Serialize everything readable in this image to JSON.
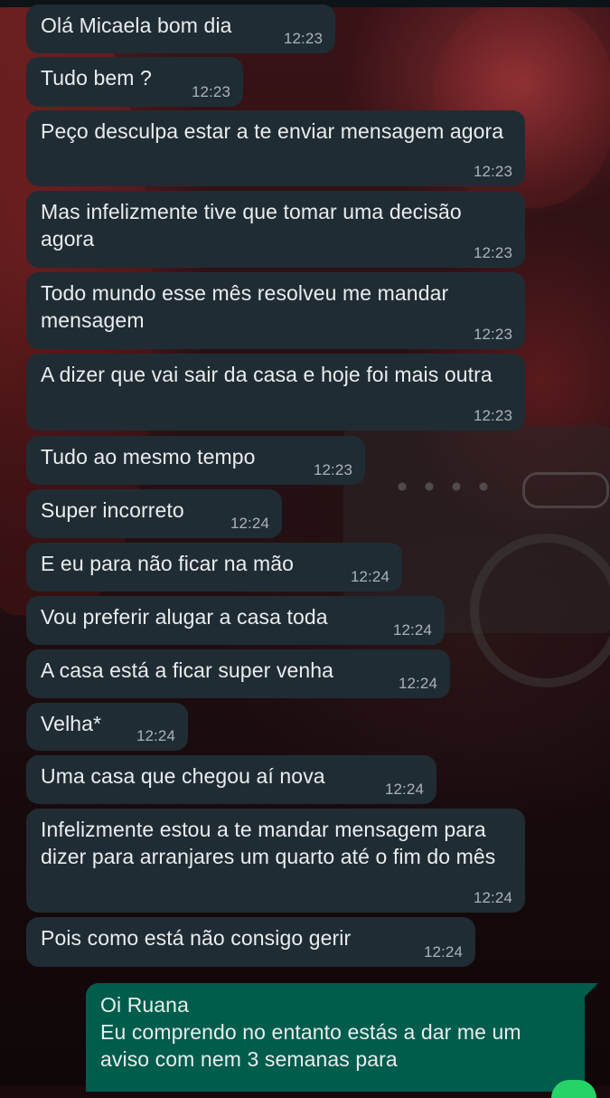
{
  "messages": [
    {
      "direction": "in",
      "text": "Olá Micaela bom dia",
      "time": "12:23"
    },
    {
      "direction": "in",
      "text": "Tudo bem ?",
      "time": "12:23"
    },
    {
      "direction": "in",
      "text": "Peço desculpa estar a te enviar mensagem agora",
      "time": "12:23"
    },
    {
      "direction": "in",
      "text": "Mas infelizmente tive que tomar uma decisão agora",
      "time": "12:23"
    },
    {
      "direction": "in",
      "text": "Todo mundo esse mês resolveu me mandar mensagem",
      "time": "12:23"
    },
    {
      "direction": "in",
      "text": "A dizer que vai sair da casa e hoje foi mais outra",
      "time": "12:23"
    },
    {
      "direction": "in",
      "text": "Tudo ao mesmo tempo",
      "time": "12:23"
    },
    {
      "direction": "in",
      "text": "Super incorreto",
      "time": "12:24"
    },
    {
      "direction": "in",
      "text": "E eu para não ficar na mão",
      "time": "12:24"
    },
    {
      "direction": "in",
      "text": "Vou preferir alugar a casa toda",
      "time": "12:24"
    },
    {
      "direction": "in",
      "text": "A casa está a ficar super venha",
      "time": "12:24"
    },
    {
      "direction": "in",
      "text": "Velha*",
      "time": "12:24"
    },
    {
      "direction": "in",
      "text": "Uma casa que chegou aí nova",
      "time": "12:24"
    },
    {
      "direction": "in",
      "text": "Infelizmente estou a te mandar mensagem para dizer para arranjares um quarto até o fim do mês",
      "time": "12:24"
    },
    {
      "direction": "in",
      "text": "Pois como está não consigo gerir",
      "time": "12:24"
    },
    {
      "direction": "out",
      "text": "Oi Ruana\nEu comprendo no entanto estás a dar me um aviso com nem 3 semanas para",
      "time": ""
    }
  ],
  "colors": {
    "incoming_bubble": "#202c33",
    "outgoing_bubble": "#005c4b",
    "message_text": "#e9edef",
    "timestamp": "#aab2b6"
  }
}
